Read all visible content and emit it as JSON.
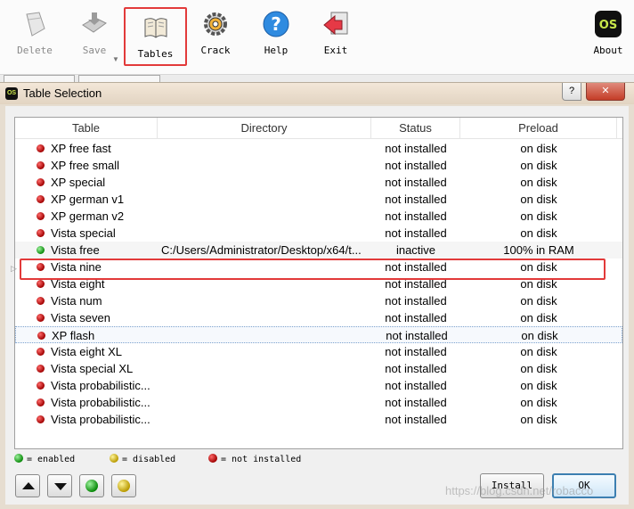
{
  "toolbar": {
    "buttons": [
      {
        "label": "Delete",
        "icon": "delete-icon",
        "disabled": true
      },
      {
        "label": "Save",
        "icon": "save-icon",
        "disabled": true
      },
      {
        "label": "Tables",
        "icon": "tables-book-icon",
        "highlighted": true
      },
      {
        "label": "Crack",
        "icon": "crack-gear-icon"
      },
      {
        "label": "Help",
        "icon": "help-icon"
      },
      {
        "label": "Exit",
        "icon": "exit-icon"
      },
      {
        "label": "About",
        "icon": "os-logo-icon"
      }
    ]
  },
  "dialog": {
    "title": "Table Selection",
    "help_glyph": "?",
    "close_glyph": "✕"
  },
  "table": {
    "columns": [
      "Table",
      "Directory",
      "Status",
      "Preload"
    ],
    "rows": [
      {
        "name": "XP free fast",
        "directory": "",
        "status": "not installed",
        "preload": "on disk",
        "state": "not_installed"
      },
      {
        "name": "XP free small",
        "directory": "",
        "status": "not installed",
        "preload": "on disk",
        "state": "not_installed"
      },
      {
        "name": "XP special",
        "directory": "",
        "status": "not installed",
        "preload": "on disk",
        "state": "not_installed"
      },
      {
        "name": "XP german v1",
        "directory": "",
        "status": "not installed",
        "preload": "on disk",
        "state": "not_installed"
      },
      {
        "name": "XP german v2",
        "directory": "",
        "status": "not installed",
        "preload": "on disk",
        "state": "not_installed"
      },
      {
        "name": "Vista special",
        "directory": "",
        "status": "not installed",
        "preload": "on disk",
        "state": "not_installed"
      },
      {
        "name": "Vista free",
        "directory": "C:/Users/Administrator/Desktop/x64/t...",
        "status": "inactive",
        "preload": "100% in RAM",
        "state": "enabled",
        "selected": true
      },
      {
        "name": "Vista nine",
        "directory": "",
        "status": "not installed",
        "preload": "on disk",
        "state": "not_installed"
      },
      {
        "name": "Vista eight",
        "directory": "",
        "status": "not installed",
        "preload": "on disk",
        "state": "not_installed"
      },
      {
        "name": "Vista num",
        "directory": "",
        "status": "not installed",
        "preload": "on disk",
        "state": "not_installed"
      },
      {
        "name": "Vista seven",
        "directory": "",
        "status": "not installed",
        "preload": "on disk",
        "state": "not_installed"
      },
      {
        "name": "XP flash",
        "directory": "",
        "status": "not installed",
        "preload": "on disk",
        "state": "not_installed",
        "focused": true
      },
      {
        "name": "Vista eight XL",
        "directory": "",
        "status": "not installed",
        "preload": "on disk",
        "state": "not_installed"
      },
      {
        "name": "Vista special XL",
        "directory": "",
        "status": "not installed",
        "preload": "on disk",
        "state": "not_installed"
      },
      {
        "name": "Vista probabilistic...",
        "directory": "",
        "status": "not installed",
        "preload": "on disk",
        "state": "not_installed"
      },
      {
        "name": "Vista probabilistic...",
        "directory": "",
        "status": "not installed",
        "preload": "on disk",
        "state": "not_installed"
      },
      {
        "name": "Vista probabilistic...",
        "directory": "",
        "status": "not installed",
        "preload": "on disk",
        "state": "not_installed"
      }
    ]
  },
  "legend": {
    "enabled": "= enabled",
    "disabled": "= disabled",
    "not_installed": "= not installed"
  },
  "buttons": {
    "install": "Install",
    "ok": "OK"
  },
  "watermark": "https://blog.csdn.net/robacco",
  "colors": {
    "highlight_red": "#e23a3a",
    "enabled_green": "#0a8a0a",
    "disabled_yellow": "#b99a00",
    "not_installed_red": "#a00000"
  }
}
